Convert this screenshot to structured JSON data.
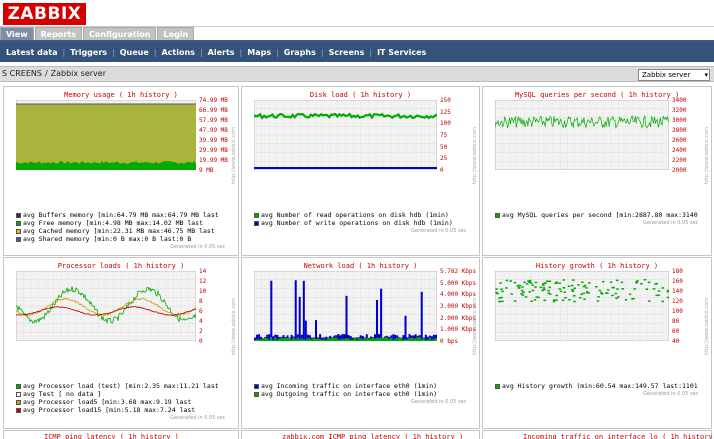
{
  "logo": "ZABBIX",
  "main_tabs": [
    {
      "label": "View",
      "active": true
    },
    {
      "label": "Reports",
      "active": false
    },
    {
      "label": "Configuration",
      "active": false
    },
    {
      "label": "Login",
      "active": false
    }
  ],
  "sub_nav": [
    "Latest data",
    "Triggers",
    "Queue",
    "Actions",
    "Alerts",
    "Maps",
    "Graphs",
    "Screens",
    "IT Services"
  ],
  "breadcrumb": {
    "section": "S CREENS",
    "page": "Zabbix server"
  },
  "host_select": "Zabbix server",
  "colors": {
    "brand": "#d40000",
    "nav": "#34527a",
    "green": "#00aa00",
    "blue": "#0000cc",
    "olive": "#a8b43c"
  },
  "graphs": [
    {
      "title": "Memory usage  ( 1h history )",
      "yticks": [
        "74.99 MB",
        "66.99 MB",
        "57.99 MB",
        "47.99 MB",
        "39.99 MB",
        "29.99 MB",
        "19.99 MB",
        "9 MB"
      ],
      "legend": [
        {
          "text": "avg Buffers memory  [min:64.79 MB max:64.79 MB last",
          "color": "#2f2f2f"
        },
        {
          "text": "avg Free memory     [min:4.98 MB max:14.02 MB last",
          "color": "#00aa00"
        },
        {
          "text": "avg Cached memory   [min:22.31 MB max:46.75 MB last",
          "color": "#c8c800"
        },
        {
          "text": "avg Shared memory   [min:0 B max:0 B last:0 B",
          "color": "#5050d0"
        }
      ],
      "chart_data": {
        "type": "area",
        "series": [
          {
            "name": "Buffers memory",
            "min": "64.79 MB",
            "max": "64.79 MB"
          },
          {
            "name": "Free memory",
            "min": "4.98 MB",
            "max": "14.02 MB"
          },
          {
            "name": "Cached memory",
            "min": "22.31 MB",
            "max": "46.75 MB"
          },
          {
            "name": "Shared memory",
            "min": "0 B",
            "max": "0 B"
          }
        ]
      }
    },
    {
      "title": "Disk load  ( 1h history )",
      "yticks": [
        "150",
        "125",
        "100",
        "75",
        "50",
        "25",
        "0"
      ],
      "legend": [
        {
          "text": "avg Number of read operations on disk hdb (1min)",
          "color": "#00aa00"
        },
        {
          "text": "avg Number of write operations on disk hdb (1min)",
          "color": "#0000cc"
        }
      ],
      "chart_data": {
        "type": "line",
        "ylim": [
          0,
          150
        ],
        "series": [
          {
            "name": "Number of read operations on disk hdb (1min)",
            "level": 120
          },
          {
            "name": "Number of write operations on disk hdb (1min)",
            "level": 2
          }
        ]
      }
    },
    {
      "title": "MySQL queries per second  ( 1h history )",
      "yticks": [
        "3400",
        "3200",
        "3000",
        "2800",
        "2600",
        "2400",
        "2200",
        "2000"
      ],
      "legend": [
        {
          "text": "avg MySQL queries per second  [min:2887.80 max:3140",
          "color": "#00aa00"
        }
      ],
      "chart_data": {
        "type": "line",
        "series": [
          {
            "name": "MySQL queries per second",
            "min": 2887.8
          }
        ]
      }
    },
    {
      "title": "Processor loads  ( 1h history )",
      "yticks": [
        "14",
        "12",
        "10",
        "8",
        "6",
        "4",
        "2",
        "0"
      ],
      "legend": [
        {
          "text": "avg Processor load (test)  [min:2.35 max:11.21 last",
          "color": "#00aa00"
        },
        {
          "text": "avg Test                  [ no data ]",
          "color": "#ffffff"
        },
        {
          "text": "avg Processor load5       [min:3.68 max:9.19 last",
          "color": "#c8a000"
        },
        {
          "text": "avg Processor load15      [min:5.18 max:7.24 last",
          "color": "#c00000"
        }
      ],
      "chart_data": {
        "type": "line",
        "ylim": [
          0,
          14
        ],
        "series": [
          {
            "name": "Processor load (test)",
            "min": 2.35,
            "max": 11.21
          },
          {
            "name": "Processor load5",
            "min": 3.68,
            "max": 9.19
          },
          {
            "name": "Processor load15",
            "min": 5.18,
            "max": 7.24
          }
        ]
      }
    },
    {
      "title": "Network load  ( 1h history )",
      "yticks": [
        "5.782 Kbps",
        "5.000 Kbps",
        "4.000 Kbps",
        "3.000 Kbps",
        "2.000 Kbps",
        "1.000 Kbps",
        "0 bps"
      ],
      "legend": [
        {
          "text": "avg Incoming traffic on interface eth0 (1min)",
          "color": "#0000cc"
        },
        {
          "text": "avg Outgoing traffic on interface eth0 (1min)",
          "color": "#00aa00"
        }
      ],
      "chart_data": {
        "type": "bar",
        "series": [
          {
            "name": "Incoming traffic on interface eth0 (1min)"
          },
          {
            "name": "Outgoing traffic on interface eth0 (1min)"
          }
        ]
      }
    },
    {
      "title": "History growth  ( 1h history )",
      "yticks": [
        "180",
        "160",
        "140",
        "120",
        "100",
        "80",
        "60",
        "40"
      ],
      "legend": [
        {
          "text": "avg History growth (min:60.54 max:149.57 last:1101",
          "color": "#00aa00"
        }
      ],
      "chart_data": {
        "type": "scatter",
        "series": [
          {
            "name": "History growth",
            "min": 60.54,
            "max": 149.57
          }
        ]
      }
    }
  ],
  "bottom_titles": [
    "ICMP ping latency  ( 1h history )",
    "zabbix.com ICMP ping latency  ( 1h history )",
    "Incoming traffic on interface lo  ( 1h history )"
  ],
  "generated_note": "Generated in 0.05 sec",
  "watermark": "http://www.zabbix.com"
}
